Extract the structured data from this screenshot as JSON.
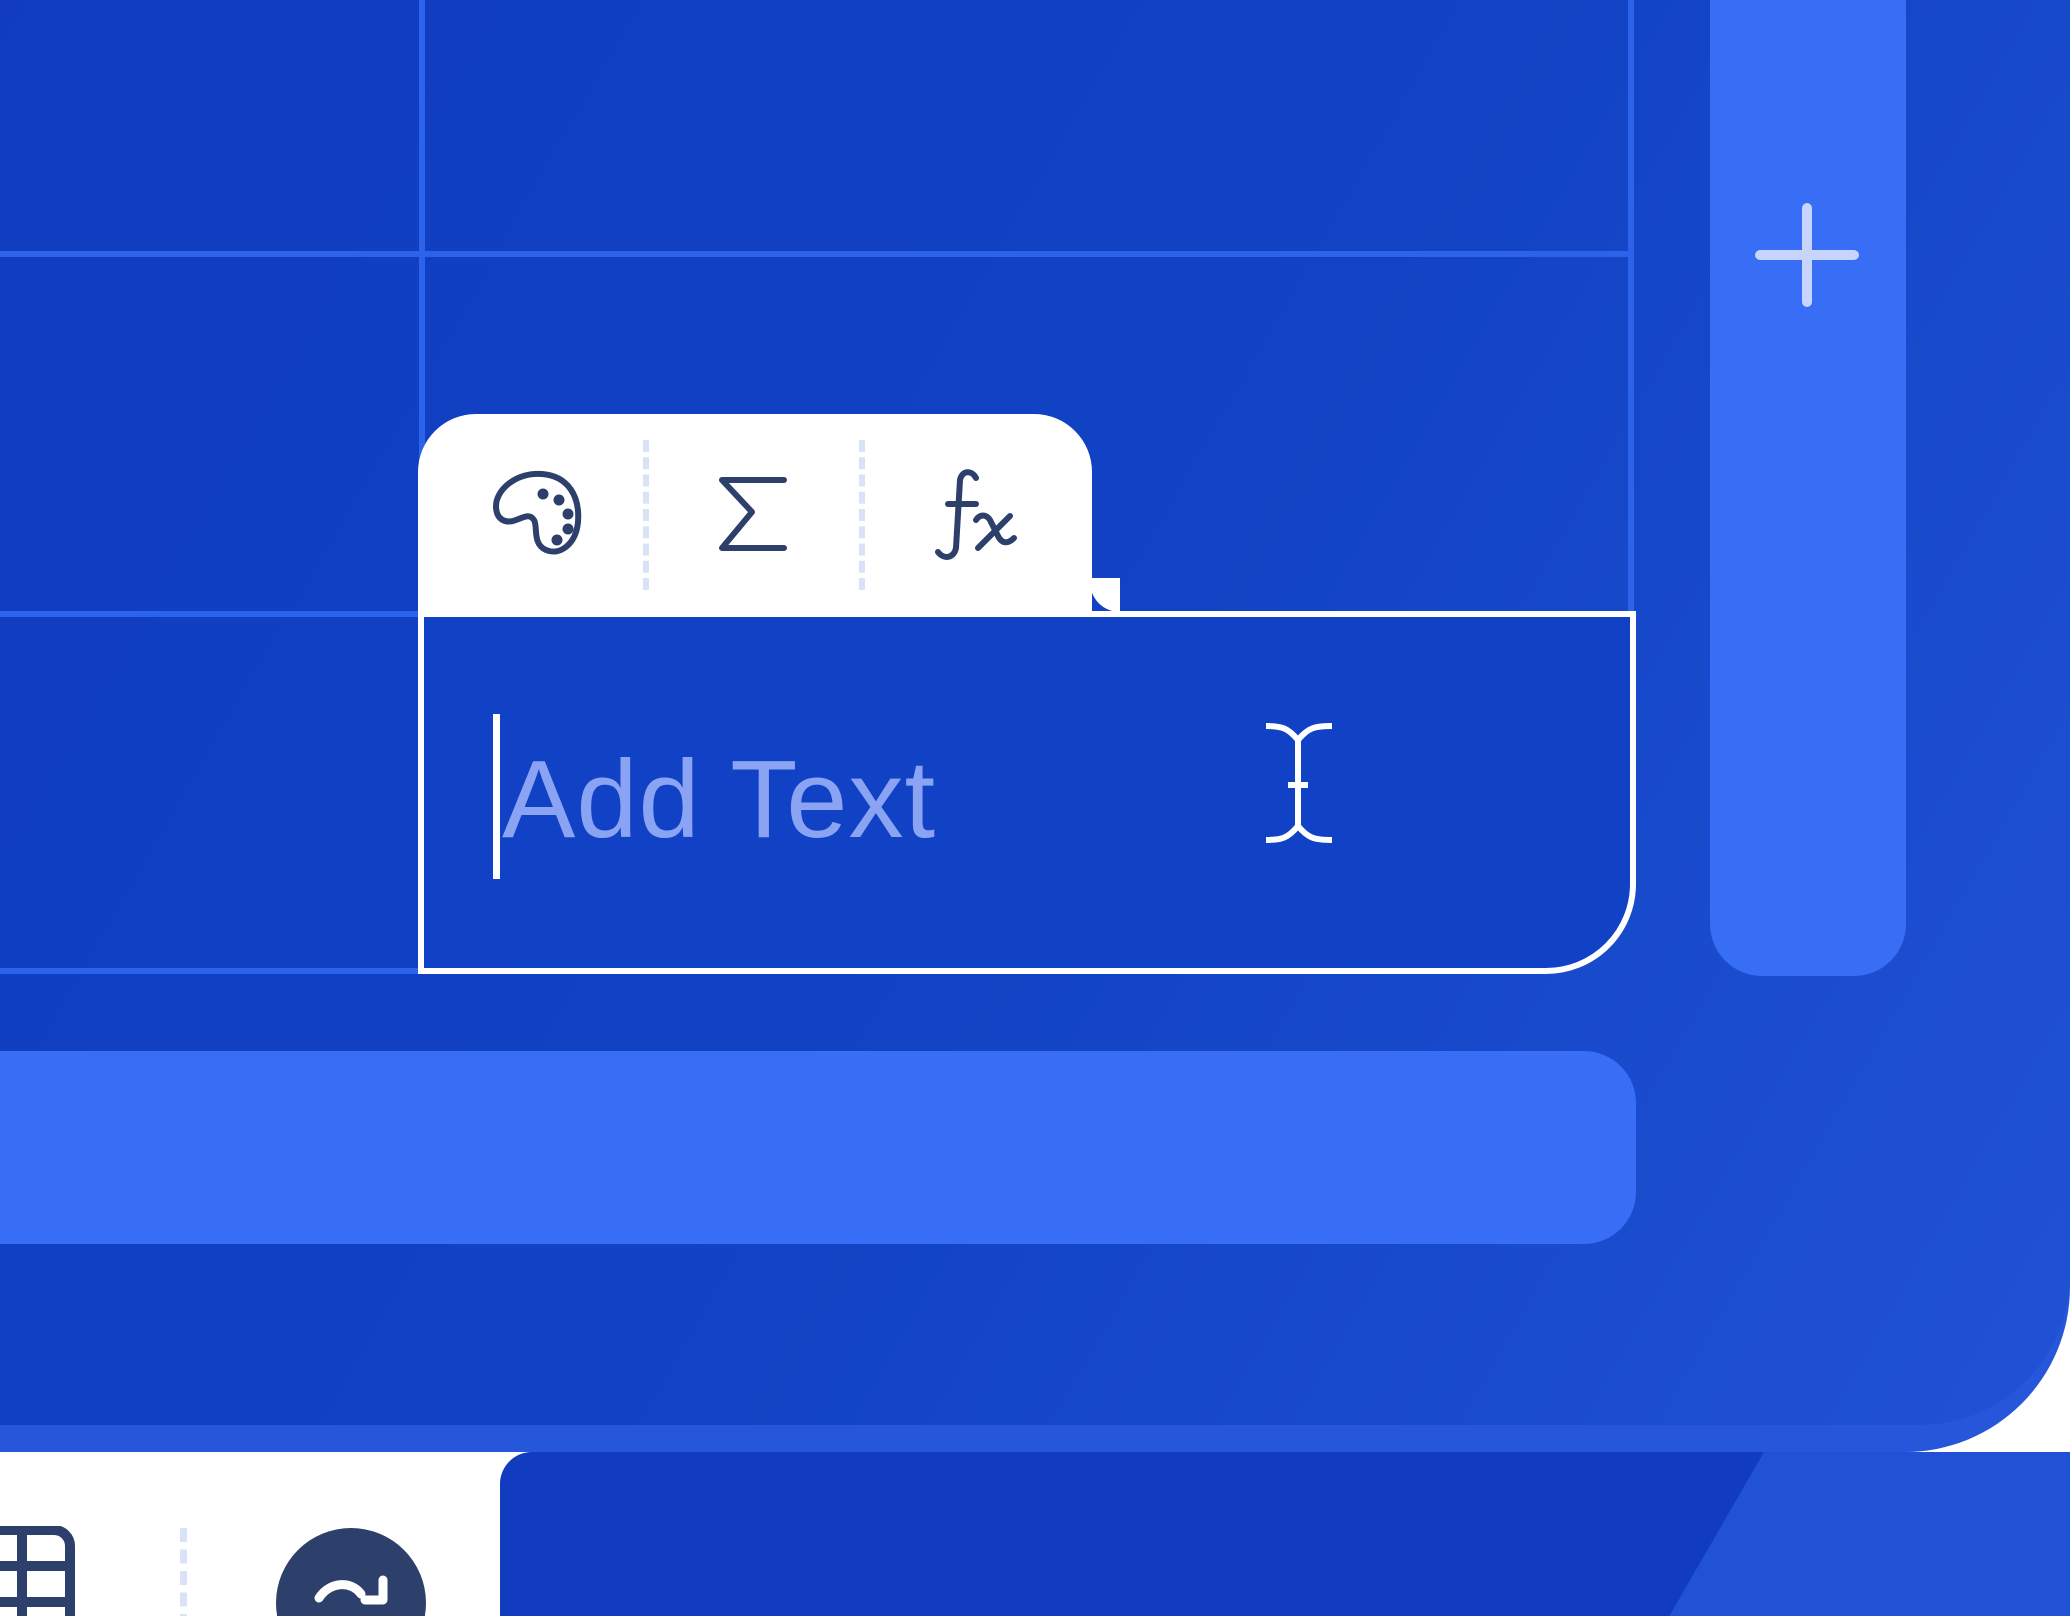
{
  "editor": {
    "placeholder": "Add Text",
    "value": ""
  },
  "toolbar": {
    "tools": [
      {
        "name": "format-style",
        "icon": "palette-icon"
      },
      {
        "name": "sum",
        "icon": "sigma-icon"
      },
      {
        "name": "formula",
        "icon": "function-fx-icon"
      }
    ]
  },
  "icons": {
    "add_column": "plus-icon",
    "text_cursor": "i-beam-cursor-icon",
    "table": "table-grid-icon",
    "sync": "sync-refresh-icon"
  },
  "colors": {
    "background_blue": "#113cbf",
    "accent_blue": "#386df5",
    "icon_navy": "#2d3f6b",
    "placeholder_text": "#8aa4f3",
    "white": "#ffffff"
  }
}
